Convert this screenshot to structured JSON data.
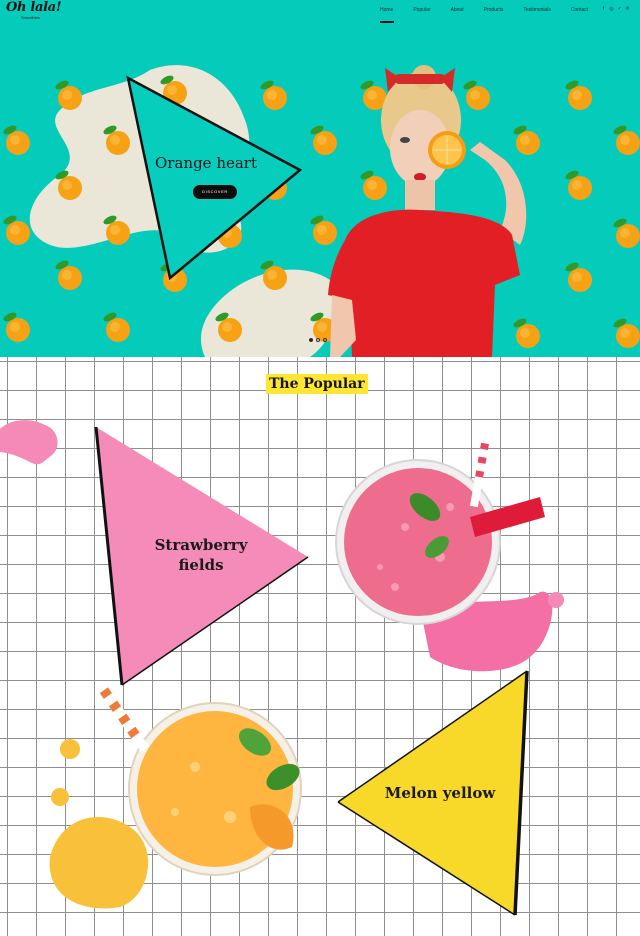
{
  "brand": {
    "name": "Oh lala!",
    "tagline": "Smoothies"
  },
  "nav": {
    "items": [
      {
        "label": "Home",
        "active": true
      },
      {
        "label": "Popular",
        "active": false
      },
      {
        "label": "About",
        "active": false
      },
      {
        "label": "Products",
        "active": false
      },
      {
        "label": "Testimonials",
        "active": false
      },
      {
        "label": "Contact",
        "active": false
      }
    ],
    "social_icons": [
      "facebook-icon",
      "instagram-icon",
      "twitter-icon",
      "pinterest-icon"
    ]
  },
  "hero": {
    "title": "Orange heart",
    "button_label": "DISCOVER",
    "slides_count": 3,
    "active_slide": 1,
    "background_color": "#05cbbb"
  },
  "popular": {
    "section_title": "The Popular",
    "cards": [
      {
        "label": "Strawberry fields",
        "color": "#f58bb8"
      },
      {
        "label": "Melon yellow",
        "color": "#f8d92a"
      }
    ]
  },
  "colors": {
    "accent_teal": "#05cbbb",
    "highlight_yellow": "#ffe633",
    "strawberry_pink": "#f58bb8",
    "melon_yellow": "#f8d92a"
  }
}
